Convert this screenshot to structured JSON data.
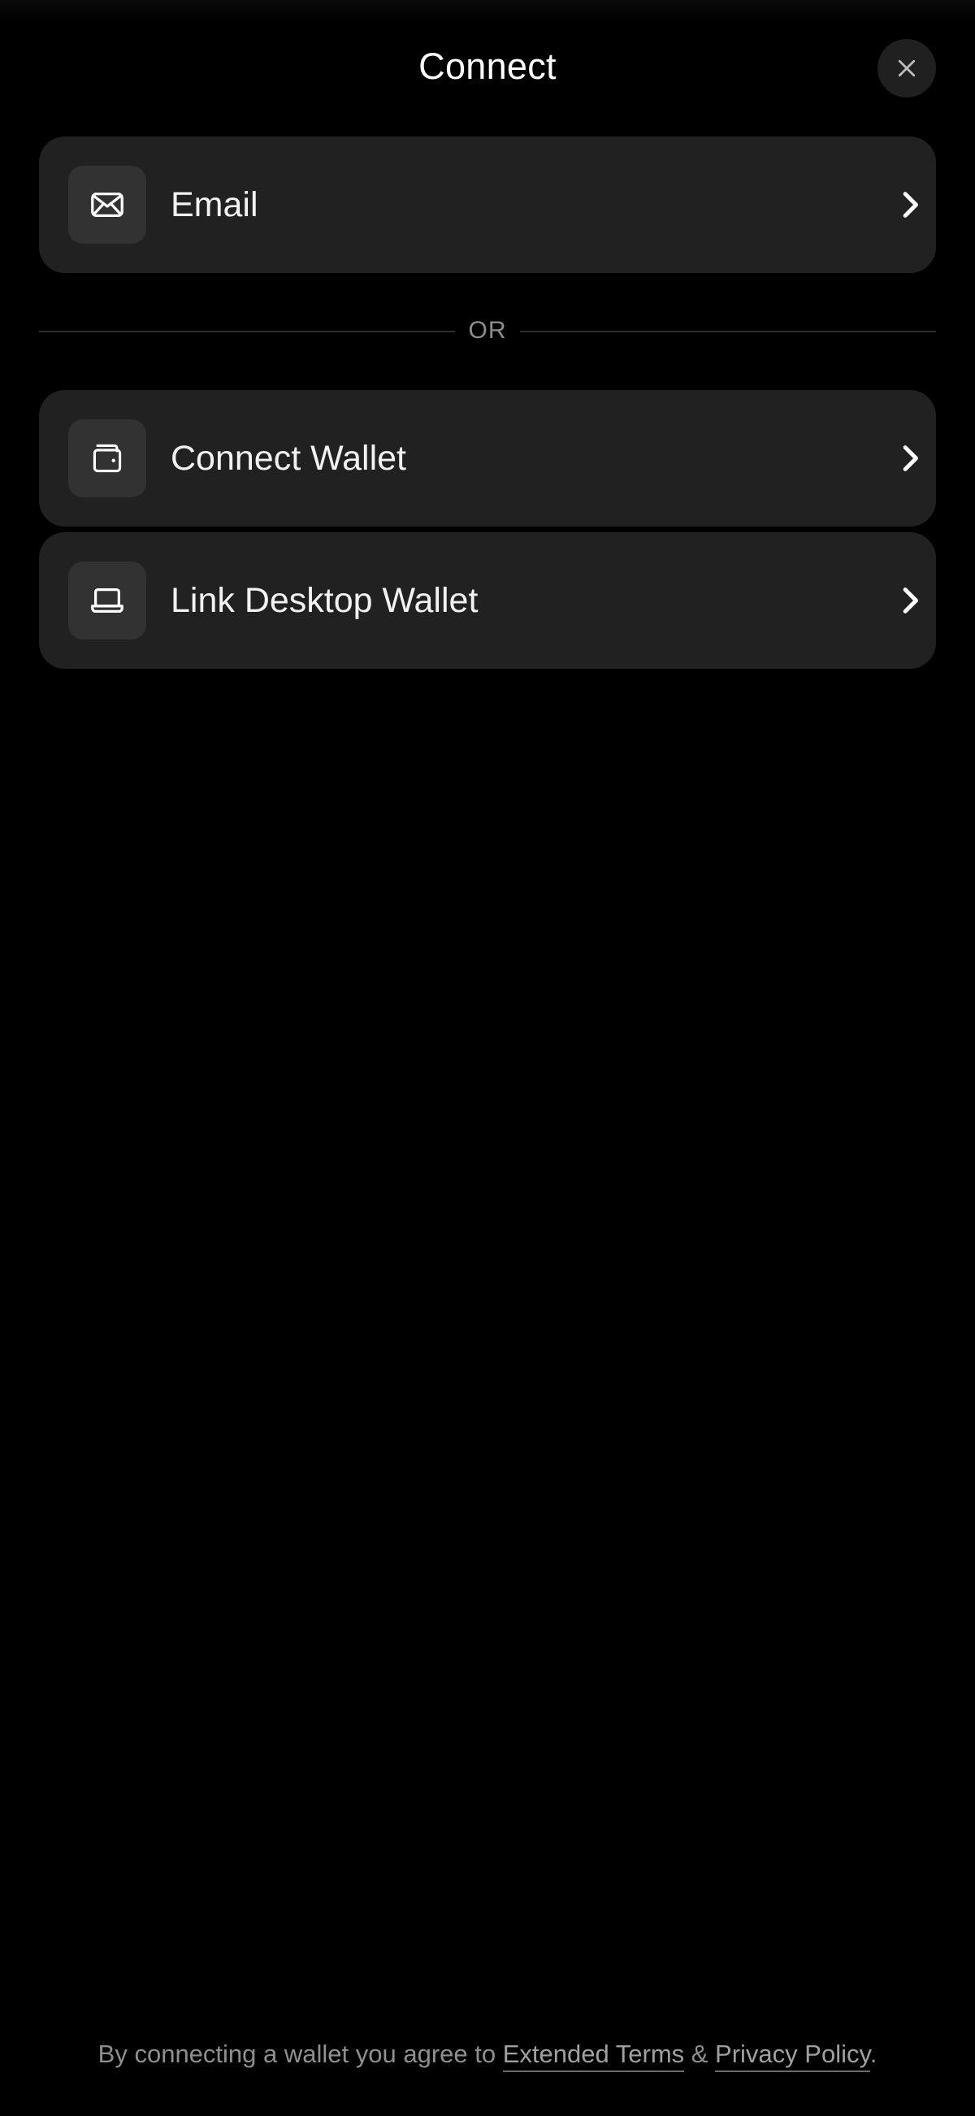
{
  "header": {
    "title": "Connect",
    "close_icon": "close-icon"
  },
  "options": [
    {
      "label": "Email",
      "icon": "mail-icon"
    },
    {
      "label": "Connect Wallet",
      "icon": "wallet-icon"
    },
    {
      "label": "Link Desktop Wallet",
      "icon": "laptop-icon"
    }
  ],
  "divider": {
    "text": "OR"
  },
  "footer": {
    "prefix": "By connecting a wallet you agree to ",
    "terms_link": "Extended Terms",
    "separator": " & ",
    "privacy_link": "Privacy Policy",
    "suffix": "."
  },
  "colors": {
    "background": "#000000",
    "card": "#212121",
    "icon_box": "#323232",
    "close_button": "#202020",
    "text_primary": "#ffffff",
    "text_muted": "#8f8f8f"
  }
}
